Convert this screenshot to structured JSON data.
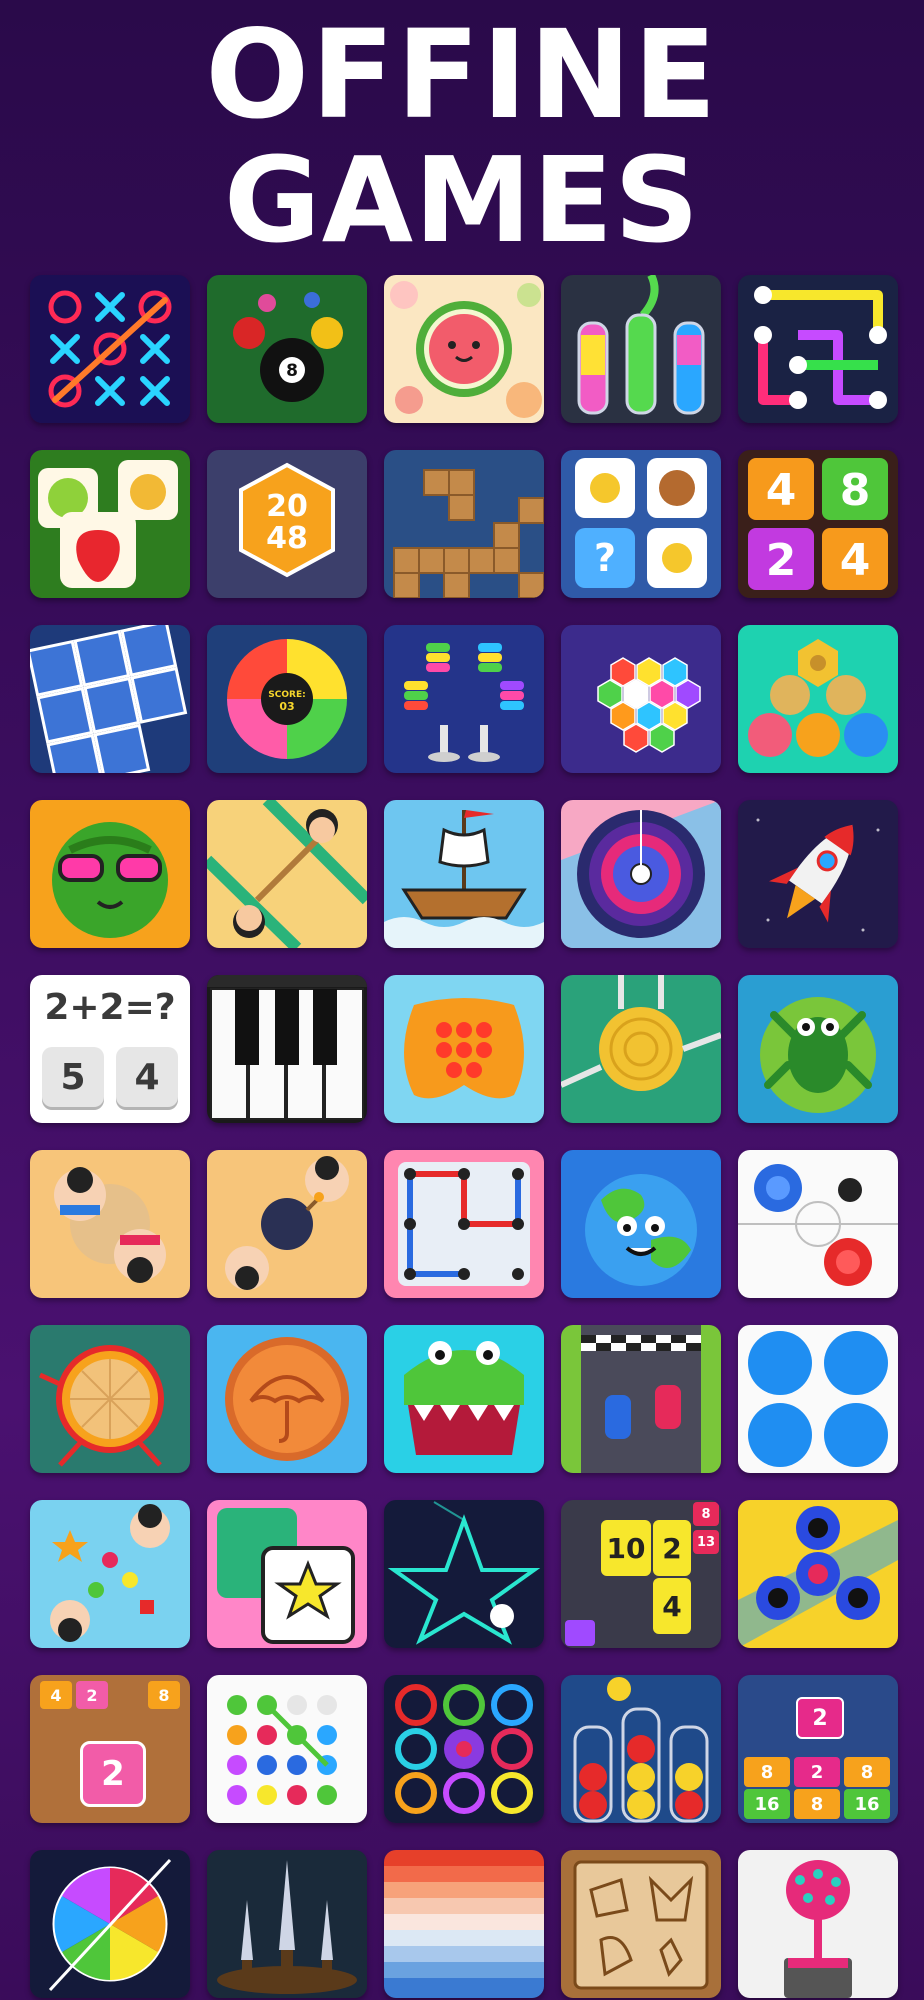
{
  "header": {
    "line1": "OFFINE",
    "line2": "GAMES"
  },
  "games": [
    {
      "icon": "tic-tac-toe-icon"
    },
    {
      "icon": "billiards-icon"
    },
    {
      "icon": "watermelon-merge-icon"
    },
    {
      "icon": "water-sort-icon"
    },
    {
      "icon": "connect-dots-icon"
    },
    {
      "icon": "fruit-tiles-icon"
    },
    {
      "icon": "hexa-2048-icon"
    },
    {
      "icon": "wood-block-icon"
    },
    {
      "icon": "memory-match-icon"
    },
    {
      "icon": "number-merge-icon"
    },
    {
      "icon": "sliding-puzzle-icon"
    },
    {
      "icon": "color-wheel-icon",
      "score_label": "SCORE:",
      "score_value": "03"
    },
    {
      "icon": "ring-stack-icon"
    },
    {
      "icon": "hexa-sort-icon"
    },
    {
      "icon": "nuts-bolts-icon"
    },
    {
      "icon": "cool-watermelon-icon"
    },
    {
      "icon": "tug-of-war-icon"
    },
    {
      "icon": "pirate-ship-icon"
    },
    {
      "icon": "spiral-wheel-icon"
    },
    {
      "icon": "rocket-icon"
    },
    {
      "icon": "math-quiz-icon",
      "equation": "2+2=?",
      "option_a": "5",
      "option_b": "4"
    },
    {
      "icon": "piano-icon"
    },
    {
      "icon": "pop-it-icon"
    },
    {
      "icon": "knife-wood-icon"
    },
    {
      "icon": "frog-icon"
    },
    {
      "icon": "sumo-wrestlers-icon"
    },
    {
      "icon": "bomb-pass-icon"
    },
    {
      "icon": "dots-boxes-icon"
    },
    {
      "icon": "earth-icon"
    },
    {
      "icon": "air-hockey-icon"
    },
    {
      "icon": "dart-wheel-icon"
    },
    {
      "icon": "dalgona-umbrella-icon"
    },
    {
      "icon": "crocodile-dentist-icon"
    },
    {
      "icon": "race-track-icon"
    },
    {
      "icon": "four-circles-icon"
    },
    {
      "icon": "candy-collect-icon"
    },
    {
      "icon": "star-cards-icon"
    },
    {
      "icon": "one-line-draw-icon"
    },
    {
      "icon": "number-blocks-icon",
      "n1": "10",
      "n2": "2",
      "n3": "4",
      "n4": "8",
      "n5": "13"
    },
    {
      "icon": "fidget-spinner-icon"
    },
    {
      "icon": "hexa-merge-icon",
      "n1": "4",
      "n2": "2",
      "n3": "8",
      "n4": "2"
    },
    {
      "icon": "dot-connect-icon"
    },
    {
      "icon": "color-rings-icon"
    },
    {
      "icon": "ball-sort-icon"
    },
    {
      "icon": "block-2048-icon",
      "n1": "2",
      "n2": "8",
      "n3": "16"
    },
    {
      "icon": "fruit-slice-icon"
    },
    {
      "icon": "knife-throw-icon"
    },
    {
      "icon": "color-stripes-icon"
    },
    {
      "icon": "wood-puzzle-icon"
    },
    {
      "icon": "paint-tree-icon"
    }
  ]
}
